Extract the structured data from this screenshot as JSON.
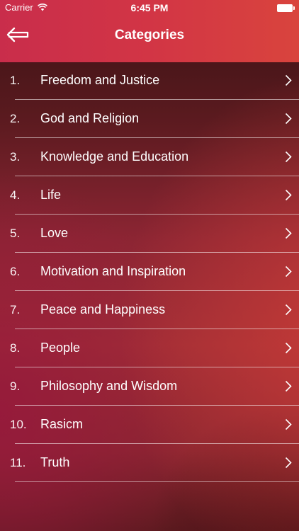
{
  "status_bar": {
    "carrier": "Carrier",
    "time": "6:45 PM"
  },
  "header": {
    "title": "Categories",
    "back_icon": "back-arrow-icon"
  },
  "categories": [
    {
      "number": "1.",
      "label": "Freedom and Justice"
    },
    {
      "number": "2.",
      "label": "God and Religion"
    },
    {
      "number": "3.",
      "label": "Knowledge and Education"
    },
    {
      "number": "4.",
      "label": "Life"
    },
    {
      "number": "5.",
      "label": "Love"
    },
    {
      "number": "6.",
      "label": "Motivation and Inspiration"
    },
    {
      "number": "7.",
      "label": "Peace and Happiness"
    },
    {
      "number": "8.",
      "label": "People"
    },
    {
      "number": "9.",
      "label": "Philosophy and Wisdom"
    },
    {
      "number": "10.",
      "label": "Rasicm"
    },
    {
      "number": "11.",
      "label": "Truth"
    }
  ],
  "colors": {
    "header_start": "#c92d4b",
    "header_end": "#d9443d",
    "text": "#ffffff"
  }
}
